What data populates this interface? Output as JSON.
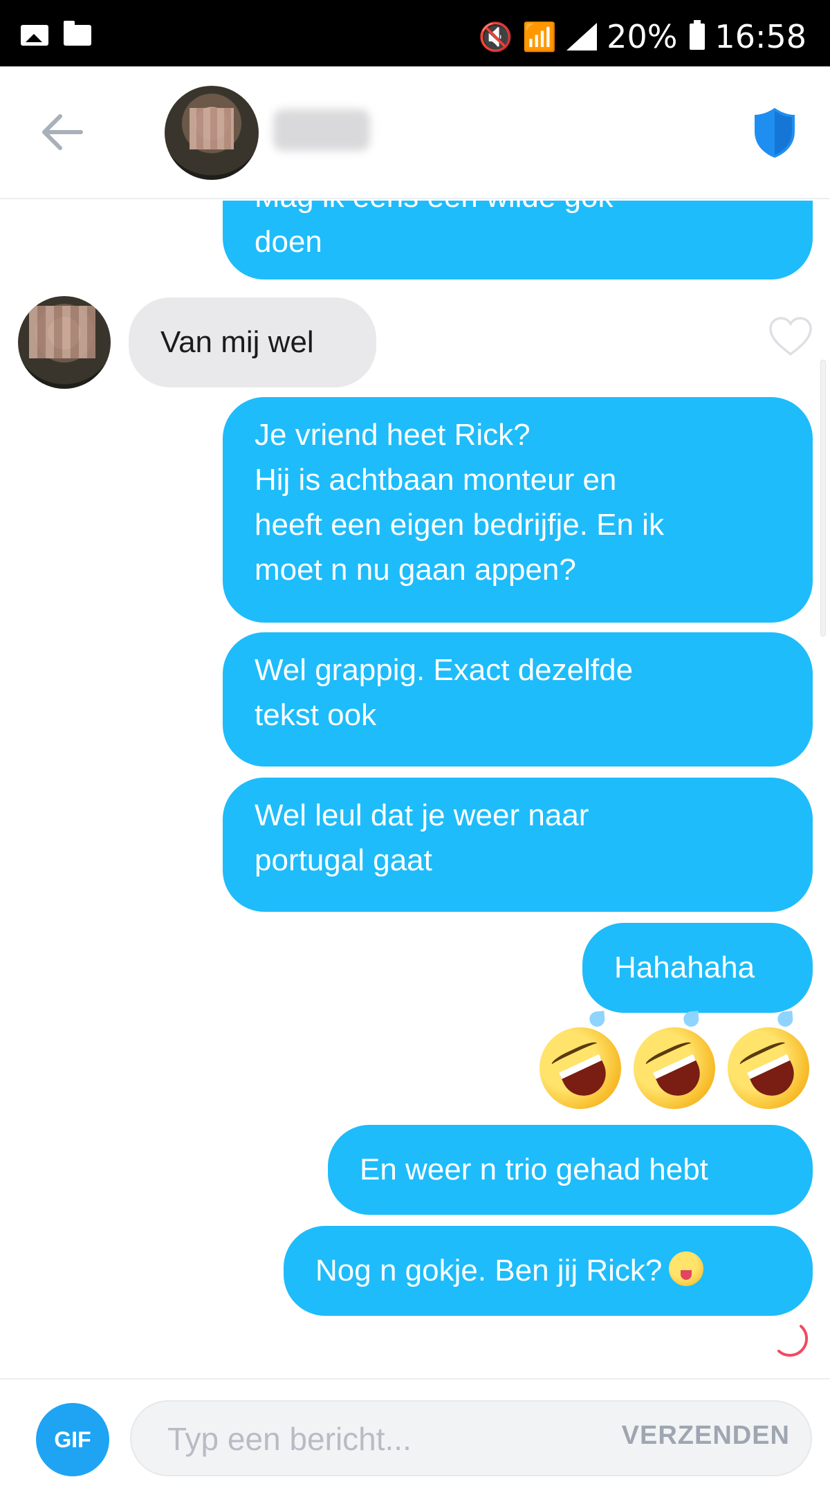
{
  "status_bar": {
    "battery": "20%",
    "time": "16:58"
  },
  "header": {
    "back_icon": "arrow-left-icon",
    "shield_icon": "shield-icon"
  },
  "messages": [
    {
      "direction": "out",
      "text": "Mag ik eens een wilde gok\ndoen"
    },
    {
      "direction": "in",
      "text": "Van mij wel"
    },
    {
      "direction": "out",
      "text": "Je vriend heet Rick?\nHij is achtbaan monteur en\nheeft een eigen bedrijfje. En ik\nmoet n nu gaan appen?"
    },
    {
      "direction": "out",
      "text": "Wel grappig. Exact dezelfde\ntekst ook"
    },
    {
      "direction": "out",
      "text": "Wel leul dat je weer naar\nportugal gaat"
    },
    {
      "direction": "out",
      "text": "Hahahaha"
    },
    {
      "direction": "out",
      "text": "En weer n trio gehad hebt"
    },
    {
      "direction": "out",
      "text": "Nog n gokje. Ben jij Rick?"
    }
  ],
  "emoji_row": [
    "rolling-on-floor-laughing-emoji",
    "rolling-on-floor-laughing-emoji",
    "rolling-on-floor-laughing-emoji"
  ],
  "composer": {
    "gif_label": "GIF",
    "placeholder": "Typ een bericht...",
    "send_label": "VERZENDEN"
  },
  "colors": {
    "outgoing_bubble": "#1ebcfa",
    "incoming_bubble": "#e9e9eb",
    "shield": "#1f8ef1",
    "gif_button": "#1ea4f3",
    "sending_spinner": "#f24a63"
  }
}
